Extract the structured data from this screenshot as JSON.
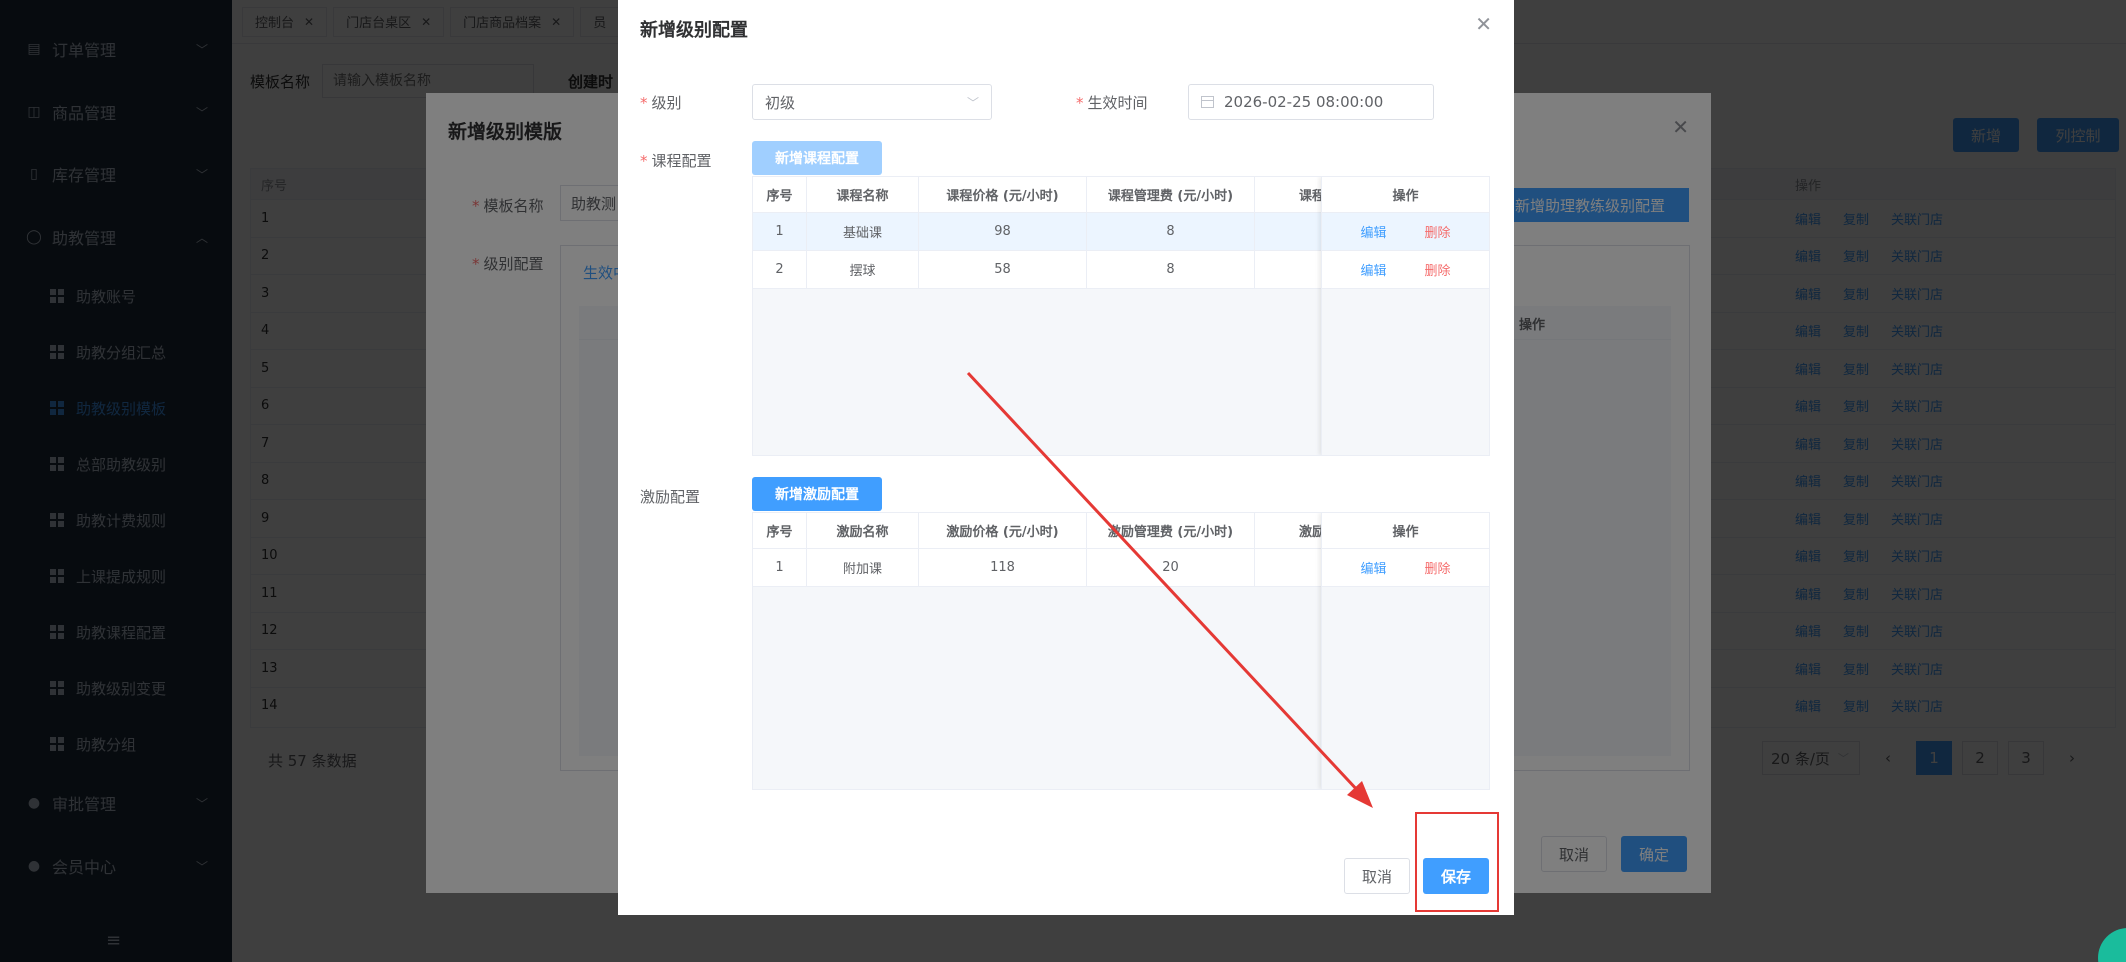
{
  "sidebar": {
    "groups": [
      {
        "label": "订单管理",
        "icon": "doc-icon",
        "expanded": false
      },
      {
        "label": "商品管理",
        "icon": "bag-icon",
        "expanded": false
      },
      {
        "label": "库存管理",
        "icon": "book-icon",
        "expanded": false
      },
      {
        "label": "助教管理",
        "icon": "user-icon",
        "expanded": true
      },
      {
        "label": "审批管理",
        "icon": "user-solid-icon",
        "expanded": false
      },
      {
        "label": "会员中心",
        "icon": "user-solid-icon",
        "expanded": false
      }
    ],
    "sub_items": [
      {
        "label": "助教账号",
        "active": false
      },
      {
        "label": "助教分组汇总",
        "active": false
      },
      {
        "label": "助教级别模板",
        "active": true
      },
      {
        "label": "总部助教级别",
        "active": false
      },
      {
        "label": "助教计费规则",
        "active": false
      },
      {
        "label": "上课提成规则",
        "active": false
      },
      {
        "label": "助教课程配置",
        "active": false
      },
      {
        "label": "助教级别变更",
        "active": false
      },
      {
        "label": "助教分组",
        "active": false
      }
    ],
    "hamburger_icon": "≡"
  },
  "tabs": [
    {
      "label": "控制台"
    },
    {
      "label": "门店台桌区"
    },
    {
      "label": "门店商品档案"
    },
    {
      "label": "员"
    }
  ],
  "search": {
    "label": "模板名称",
    "placeholder": "请输入模板名称",
    "label2": "创建时"
  },
  "top_buttons": {
    "add": "新增",
    "columns": "列控制"
  },
  "bg_table": {
    "header_index": "序号",
    "header_ops": "操作",
    "rows": [
      "1",
      "2",
      "3",
      "4",
      "5",
      "6",
      "7",
      "8",
      "9",
      "10",
      "11",
      "12",
      "13",
      "14"
    ],
    "ops": [
      "编辑",
      "复制",
      "关联门店"
    ]
  },
  "bg_footer": {
    "total": "共 57 条数据",
    "page_size": "20 条/页",
    "pages": [
      "1",
      "2",
      "3"
    ],
    "prev": "‹",
    "next": "›"
  },
  "dialog1": {
    "title": "新增级别模版",
    "template_name_label": "模板名称",
    "template_name_value": "助教测",
    "level_config_label": "级别配置",
    "effective_tab": "生效中",
    "add_assistant_level": "新增助理教练级别配置",
    "inner_ops_header": "操作",
    "cancel": "取消",
    "confirm": "确定"
  },
  "dialog2": {
    "title": "新增级别配置",
    "level_label": "级别",
    "level_value": "初级",
    "effective_time_label": "生效时间",
    "effective_time_value": "2026-02-25 08:00:00",
    "course_config_label": "课程配置",
    "add_course_btn": "新增课程配置",
    "course_table": {
      "headers": [
        "序号",
        "课程名称",
        "课程价格 (元/小时)",
        "课程管理费 (元/小时)",
        "课程"
      ],
      "ops_header": "操作",
      "rows": [
        {
          "index": "1",
          "name": "基础课",
          "price": "98",
          "fee": "8",
          "edit": "编辑",
          "delete": "删除"
        },
        {
          "index": "2",
          "name": "摆球",
          "price": "58",
          "fee": "8",
          "edit": "编辑",
          "delete": "删除"
        }
      ]
    },
    "incentive_config_label": "激励配置",
    "add_incentive_btn": "新增激励配置",
    "incentive_table": {
      "headers": [
        "序号",
        "激励名称",
        "激励价格 (元/小时)",
        "激励管理费 (元/小时)",
        "激励"
      ],
      "ops_header": "操作",
      "rows": [
        {
          "index": "1",
          "name": "附加课",
          "price": "118",
          "fee": "20",
          "edit": "编辑",
          "delete": "删除"
        }
      ]
    },
    "cancel": "取消",
    "save": "保存"
  },
  "colors": {
    "primary": "#409eff",
    "danger": "#f56c6c",
    "sidebar_bg": "#1f2d3d",
    "annotation_red": "#e53935"
  }
}
